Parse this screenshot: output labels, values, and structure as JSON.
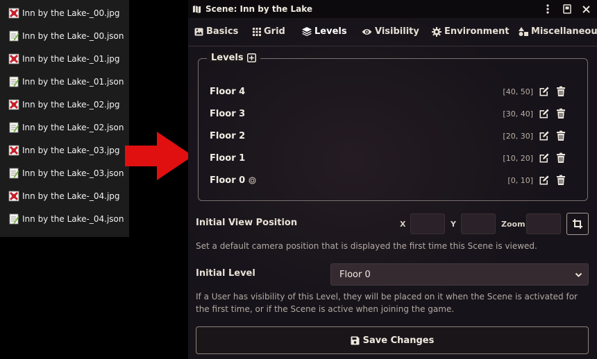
{
  "files": [
    {
      "name": "Inn by the Lake-_00.jpg",
      "type": "image"
    },
    {
      "name": "Inn by the Lake-_00.json",
      "type": "json"
    },
    {
      "name": "Inn by the Lake-_01.jpg",
      "type": "image"
    },
    {
      "name": "Inn by the Lake-_01.json",
      "type": "json"
    },
    {
      "name": "Inn by the Lake-_02.jpg",
      "type": "image"
    },
    {
      "name": "Inn by the Lake-_02.json",
      "type": "json"
    },
    {
      "name": "Inn by the Lake-_03.jpg",
      "type": "image"
    },
    {
      "name": "Inn by the Lake-_03.json",
      "type": "json"
    },
    {
      "name": "Inn by the Lake-_04.jpg",
      "type": "image"
    },
    {
      "name": "Inn by the Lake-_04.json",
      "type": "json"
    }
  ],
  "arrow_color": "#e01010",
  "dialog": {
    "title": "Scene: Inn by the Lake",
    "tabs": [
      {
        "label": "Basics",
        "icon": "image-icon"
      },
      {
        "label": "Grid",
        "icon": "grid-icon"
      },
      {
        "label": "Levels",
        "icon": "layers-icon",
        "active": true
      },
      {
        "label": "Visibility",
        "icon": "eye-icon"
      },
      {
        "label": "Environment",
        "icon": "cog-icon"
      },
      {
        "label": "Miscellaneous",
        "icon": "shapes-icon"
      }
    ],
    "levels": {
      "legend": "Levels",
      "items": [
        {
          "name": "Floor 4",
          "range": "[40, 50]"
        },
        {
          "name": "Floor 3",
          "range": "[30, 40]"
        },
        {
          "name": "Floor 2",
          "range": "[20, 30]"
        },
        {
          "name": "Floor 1",
          "range": "[10, 20]"
        },
        {
          "name": "Floor 0",
          "range": "[0, 10]",
          "is_initial": true
        }
      ]
    },
    "initial_view": {
      "label": "Initial View Position",
      "x_label": "X",
      "y_label": "Y",
      "zoom_label": "Zoom",
      "x_value": "",
      "y_value": "",
      "zoom_value": "",
      "hint": "Set a default camera position that is displayed the first time this Scene is viewed."
    },
    "initial_level": {
      "label": "Initial Level",
      "selected": "Floor 0",
      "hint": "If a User has visibility of this Level, they will be placed on it when the Scene is activated for the first time, or if the Scene is active when joining the game."
    },
    "save_label": "Save Changes"
  }
}
